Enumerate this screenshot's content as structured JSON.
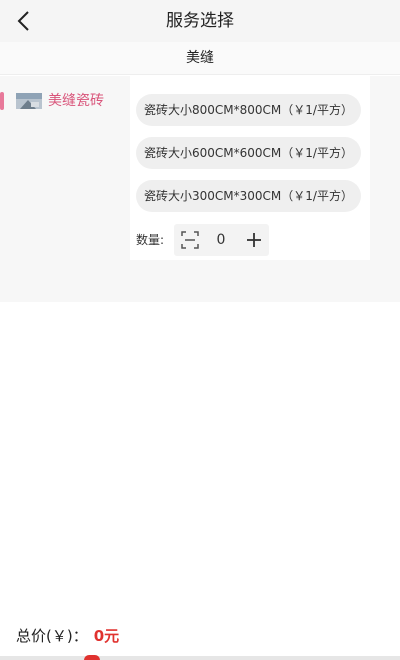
{
  "header": {
    "title": "服务选择",
    "back_icon": "chevron-left-icon"
  },
  "subheader": {
    "label": "美缝"
  },
  "sidebar": {
    "items": [
      {
        "label": "美缝瓷砖",
        "icon": "tile-thumbnail-icon",
        "selected": true
      }
    ]
  },
  "specs": [
    {
      "label": "瓷砖大小800CM*800CM（￥1/平方）"
    },
    {
      "label": "瓷砖大小600CM*600CM（￥1/平方）"
    },
    {
      "label": "瓷砖大小300CM*300CM（￥1/平方）"
    }
  ],
  "quantity": {
    "label": "数量:",
    "value": "0",
    "minus_icon": "minus-icon",
    "plus_icon": "plus-icon"
  },
  "footer": {
    "total_label": "总价(￥)：",
    "total_value": "0元"
  },
  "colors": {
    "accent": "#e0322f",
    "sidebar_selected": "#d9547a",
    "indicator": "#e8799a"
  }
}
